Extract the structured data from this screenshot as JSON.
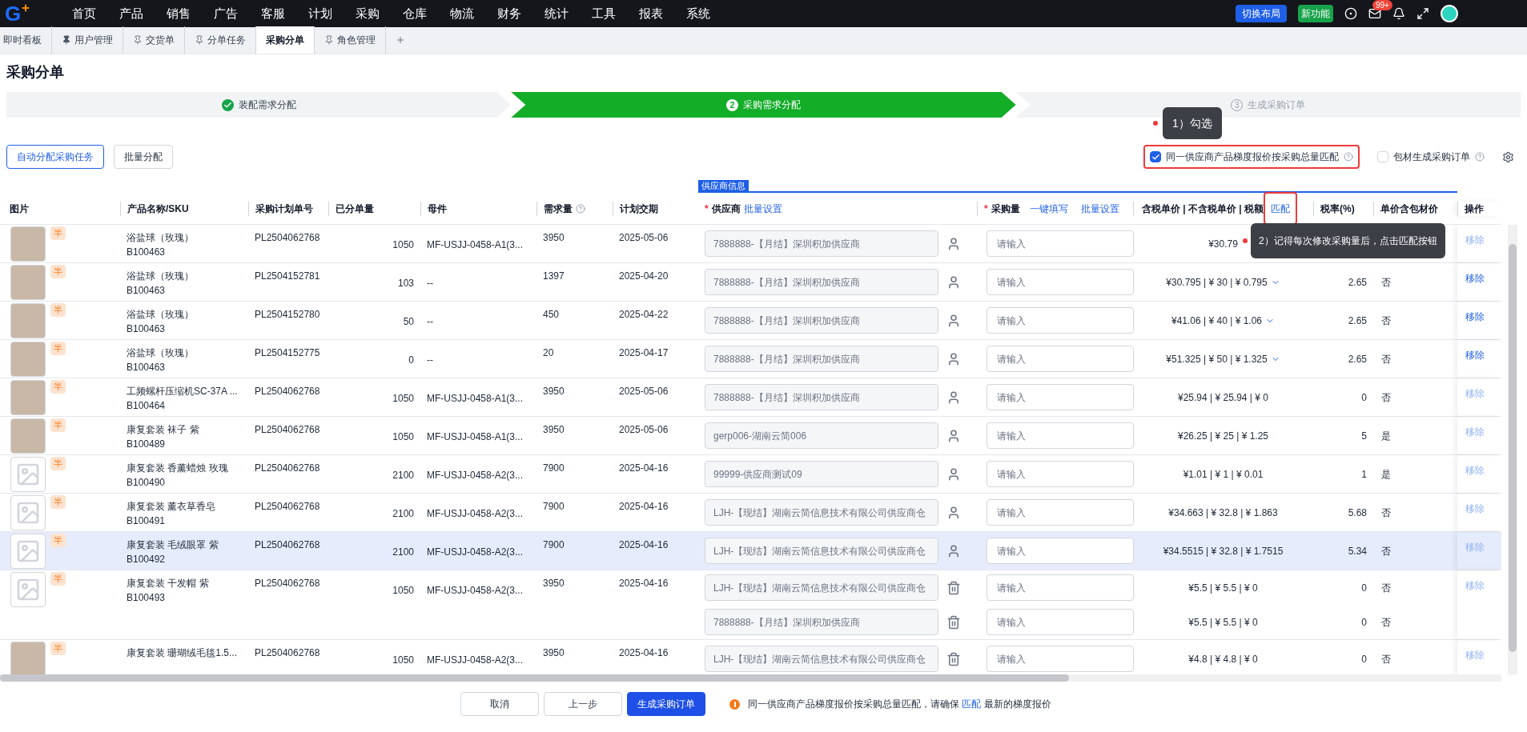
{
  "nav": {
    "logo": "G",
    "items": [
      "首页",
      "产品",
      "销售",
      "广告",
      "客服",
      "计划",
      "采购",
      "仓库",
      "物流",
      "财务",
      "统计",
      "工具",
      "报表",
      "系统"
    ],
    "switch_layout": "切换布局",
    "new_feature": "新功能",
    "mail_badge": "99+"
  },
  "tabs": [
    {
      "label": "即时看板",
      "kind": "plain",
      "selected": false
    },
    {
      "label": "用户管理",
      "kind": "pinned",
      "selected": false
    },
    {
      "label": "交货单",
      "kind": "pinnable",
      "selected": false
    },
    {
      "label": "分单任务",
      "kind": "pinnable",
      "selected": false
    },
    {
      "label": "采购分单",
      "kind": "plain",
      "selected": true
    },
    {
      "label": "角色管理",
      "kind": "pinnable",
      "selected": false
    }
  ],
  "page_title": "采购分单",
  "steps": [
    {
      "label": "装配需求分配",
      "kind": "done"
    },
    {
      "label": "采购需求分配",
      "number": "2",
      "kind": "active"
    },
    {
      "label": "生成采购订单",
      "number": "3",
      "kind": "pending"
    }
  ],
  "toolbar": {
    "buttons": [
      {
        "label": "自动分配采购任务",
        "kind": "outline"
      },
      {
        "label": "批量分配",
        "kind": "default"
      }
    ],
    "options": [
      {
        "label": "同一供应商产品梯度报价按采购总量匹配",
        "checked": true,
        "highlighted": true
      },
      {
        "label": "包材生成采购订单",
        "checked": false,
        "highlighted": false
      }
    ]
  },
  "annotations": [
    {
      "text": "1）勾选"
    },
    {
      "text": "2）记得每次修改采购量后，点击匹配按钮"
    }
  ],
  "table": {
    "group_header": "供应商信息",
    "columns": {
      "image": "图片",
      "product": "产品名称/SKU",
      "plan_no": "采购计划单号",
      "allocated": "已分单量",
      "parent": "母件",
      "demand": "需求量",
      "delivery": "计划交期",
      "supplier_required": "*",
      "supplier": "供应商",
      "supplier_link": "批量设置",
      "qty_required": "*",
      "qty": "采购量",
      "qty_fill": "一键填写",
      "qty_batch": "批量设置",
      "price": "含税单价 | 不含税单价 | 税额",
      "match": "匹配",
      "tax": "税率(%)",
      "packaging": "单价含包材价",
      "action": "操作"
    },
    "rows": [
      {
        "kind": "photo",
        "tag": "半",
        "name": "浴盐球（玫瑰）",
        "sku": "B100463",
        "plan_no": "PL2504062768",
        "allocated": "1050",
        "parent": "MF-USJJ-0458-A1(3...",
        "demand": "3950",
        "delivery": "2025-05-06",
        "selected": false,
        "remove": "移除",
        "remove_disabled": true,
        "lines": [
          {
            "supplier": "7888888-【月结】深圳积加供应商",
            "kind": "person",
            "placeholder": "请输入",
            "price": "¥30.79",
            "expandable": false
          }
        ]
      },
      {
        "kind": "photo",
        "tag": "半",
        "name": "浴盐球（玫瑰）",
        "sku": "B100463",
        "plan_no": "PL2504152781",
        "allocated": "103",
        "parent": "--",
        "demand": "1397",
        "delivery": "2025-04-20",
        "selected": false,
        "remove": "移除",
        "remove_disabled": false,
        "lines": [
          {
            "supplier": "7888888-【月结】深圳积加供应商",
            "kind": "person",
            "placeholder": "请输入",
            "price": "¥30.795 | ¥ 30 | ¥ 0.795",
            "expandable": true,
            "tax": "2.65",
            "packaging": "否"
          }
        ]
      },
      {
        "kind": "photo",
        "tag": "半",
        "name": "浴盐球（玫瑰）",
        "sku": "B100463",
        "plan_no": "PL2504152780",
        "allocated": "50",
        "parent": "--",
        "demand": "450",
        "delivery": "2025-04-22",
        "selected": false,
        "remove": "移除",
        "remove_disabled": false,
        "lines": [
          {
            "supplier": "7888888-【月结】深圳积加供应商",
            "kind": "person",
            "placeholder": "请输入",
            "price": "¥41.06 | ¥ 40 | ¥ 1.06",
            "expandable": true,
            "tax": "2.65",
            "packaging": "否"
          }
        ]
      },
      {
        "kind": "photo",
        "tag": "半",
        "name": "浴盐球（玫瑰）",
        "sku": "B100463",
        "plan_no": "PL2504152775",
        "allocated": "0",
        "parent": "--",
        "demand": "20",
        "delivery": "2025-04-17",
        "selected": false,
        "remove": "移除",
        "remove_disabled": false,
        "lines": [
          {
            "supplier": "7888888-【月结】深圳积加供应商",
            "kind": "person",
            "placeholder": "请输入",
            "price": "¥51.325 | ¥ 50 | ¥ 1.325",
            "expandable": true,
            "tax": "2.65",
            "packaging": "否"
          }
        ]
      },
      {
        "kind": "photo",
        "tag": "半",
        "name": "工频螺杆压缩机SC-37A ...",
        "sku": "B100464",
        "plan_no": "PL2504062768",
        "allocated": "1050",
        "parent": "MF-USJJ-0458-A1(3...",
        "demand": "3950",
        "delivery": "2025-05-06",
        "selected": false,
        "remove": "移除",
        "remove_disabled": true,
        "lines": [
          {
            "supplier": "7888888-【月结】深圳积加供应商",
            "kind": "person",
            "placeholder": "请输入",
            "price": "¥25.94 | ¥ 25.94 | ¥ 0",
            "expandable": false,
            "tax": "0",
            "packaging": "否"
          }
        ]
      },
      {
        "kind": "photo",
        "tag": "半",
        "name": "康复套装 袜子 紫",
        "sku": "B100489",
        "plan_no": "PL2504062768",
        "allocated": "1050",
        "parent": "MF-USJJ-0458-A1(3...",
        "demand": "3950",
        "delivery": "2025-05-06",
        "selected": false,
        "remove": "移除",
        "remove_disabled": true,
        "lines": [
          {
            "supplier": "gerp006-湖南云简006",
            "kind": "person",
            "placeholder": "请输入",
            "price": "¥26.25 | ¥ 25 | ¥ 1.25",
            "expandable": false,
            "tax": "5",
            "packaging": "是"
          }
        ]
      },
      {
        "kind": "placeholder",
        "tag": "半",
        "name": "康复套装 香薰蜡烛 玫瑰",
        "sku": "B100490",
        "plan_no": "PL2504062768",
        "allocated": "2100",
        "parent": "MF-USJJ-0458-A2(3...",
        "demand": "7900",
        "delivery": "2025-04-16",
        "selected": false,
        "remove": "移除",
        "remove_disabled": true,
        "lines": [
          {
            "supplier": "99999-供应商测试09",
            "kind": "person",
            "placeholder": "请输入",
            "price": "¥1.01 | ¥ 1 | ¥ 0.01",
            "expandable": false,
            "tax": "1",
            "packaging": "是"
          }
        ]
      },
      {
        "kind": "placeholder",
        "tag": "半",
        "name": "康复套装 薰衣草香皂",
        "sku": "B100491",
        "plan_no": "PL2504062768",
        "allocated": "2100",
        "parent": "MF-USJJ-0458-A2(3...",
        "demand": "7900",
        "delivery": "2025-04-16",
        "selected": false,
        "remove": "移除",
        "remove_disabled": true,
        "lines": [
          {
            "supplier": "LJH-【现结】湖南云简信息技术有限公司供应商仓",
            "kind": "person",
            "placeholder": "请输入",
            "price": "¥34.663 | ¥ 32.8 | ¥ 1.863",
            "expandable": false,
            "tax": "5.68",
            "packaging": "否"
          }
        ]
      },
      {
        "kind": "placeholder",
        "tag": "半",
        "name": "康复套装 毛绒眼罩 紫",
        "sku": "B100492",
        "plan_no": "PL2504062768",
        "allocated": "2100",
        "parent": "MF-USJJ-0458-A2(3...",
        "demand": "7900",
        "delivery": "2025-04-16",
        "selected": true,
        "remove": "移除",
        "remove_disabled": true,
        "lines": [
          {
            "supplier": "LJH-【现结】湖南云简信息技术有限公司供应商仓",
            "kind": "person",
            "placeholder": "请输入",
            "price": "¥34.5515 | ¥ 32.8 | ¥ 1.7515",
            "expandable": false,
            "tax": "5.34",
            "packaging": "否"
          }
        ]
      },
      {
        "kind": "placeholder",
        "tag": "半",
        "name": "康复套装 干发帽 紫",
        "sku": "B100493",
        "plan_no": "PL2504062768",
        "allocated": "1050",
        "parent": "MF-USJJ-0458-A2(3...",
        "demand": "3950",
        "delivery": "2025-04-16",
        "selected": false,
        "remove": "移除",
        "remove_disabled": true,
        "lines": [
          {
            "supplier": "LJH-【现结】湖南云简信息技术有限公司供应商仓",
            "kind": "trash",
            "placeholder": "请输入",
            "price": "¥5.5 | ¥ 5.5 | ¥ 0",
            "expandable": false,
            "tax": "0",
            "packaging": "否"
          },
          {
            "supplier": "7888888-【月结】深圳积加供应商",
            "kind": "trash",
            "placeholder": "请输入",
            "price": "¥5.5 | ¥ 5.5 | ¥ 0",
            "expandable": false,
            "tax": "0",
            "packaging": "否"
          }
        ]
      },
      {
        "kind": "photo",
        "tag": "半",
        "name": "康复套装 珊瑚绒毛毯1.5...",
        "plan_no": "PL2504062768",
        "allocated": "1050",
        "parent": "MF-USJJ-0458-A2(3...",
        "demand": "3950",
        "delivery": "2025-04-16",
        "selected": false,
        "remove": "移除",
        "remove_disabled": true,
        "lines": [
          {
            "supplier": "LJH-【现结】湖南云简信息技术有限公司供应商仓",
            "kind": "trash",
            "placeholder": "请输入",
            "price": "¥4.8 | ¥ 4.8 | ¥ 0",
            "expandable": false,
            "tax": "0",
            "packaging": "否"
          }
        ]
      }
    ]
  },
  "footer": {
    "buttons": [
      {
        "label": "取消",
        "kind": "default"
      },
      {
        "label": "上一步",
        "kind": "default"
      },
      {
        "label": "生成采购订单",
        "kind": "primary"
      }
    ],
    "notice_before": "同一供应商产品梯度报价按采购总量匹配，请确保",
    "notice_link": "匹配",
    "notice_after": "最新的梯度报价"
  }
}
